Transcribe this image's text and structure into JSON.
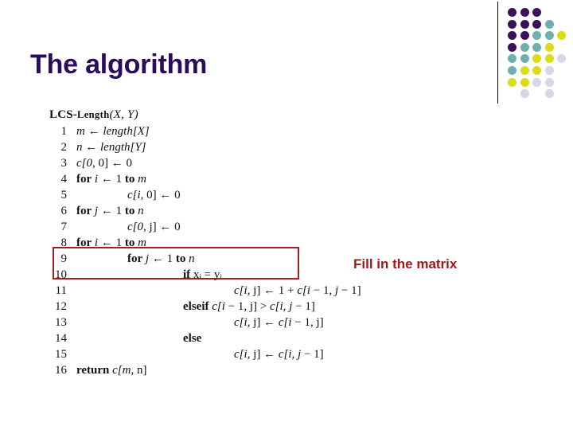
{
  "slide": {
    "title": "The algorithm",
    "title_color": "#2B0B5E",
    "background_color": "#FFFFFF"
  },
  "decor": {
    "name": "dot-grid-motif",
    "rule_color": "#000000",
    "colors": {
      "purple": "#3B1259",
      "teal": "#6FAFAF",
      "yellow": "#DBDB18",
      "lavender": "#D5D6E6"
    },
    "dots": [
      {
        "row": 0,
        "col": 0,
        "color": "#3B1259"
      },
      {
        "row": 0,
        "col": 1,
        "color": "#3B1259"
      },
      {
        "row": 0,
        "col": 2,
        "color": "#3B1259"
      },
      {
        "row": 1,
        "col": 0,
        "color": "#3B1259"
      },
      {
        "row": 1,
        "col": 1,
        "color": "#3B1259"
      },
      {
        "row": 1,
        "col": 2,
        "color": "#3B1259"
      },
      {
        "row": 1,
        "col": 3,
        "color": "#6FAFAF"
      },
      {
        "row": 2,
        "col": 0,
        "color": "#3B1259"
      },
      {
        "row": 2,
        "col": 1,
        "color": "#3B1259"
      },
      {
        "row": 2,
        "col": 2,
        "color": "#6FAFAF"
      },
      {
        "row": 2,
        "col": 3,
        "color": "#6FAFAF"
      },
      {
        "row": 2,
        "col": 4,
        "color": "#DBDB18"
      },
      {
        "row": 3,
        "col": 0,
        "color": "#3B1259"
      },
      {
        "row": 3,
        "col": 1,
        "color": "#6FAFAF"
      },
      {
        "row": 3,
        "col": 2,
        "color": "#6FAFAF"
      },
      {
        "row": 3,
        "col": 3,
        "color": "#DBDB18"
      },
      {
        "row": 4,
        "col": 0,
        "color": "#6FAFAF"
      },
      {
        "row": 4,
        "col": 1,
        "color": "#6FAFAF"
      },
      {
        "row": 4,
        "col": 2,
        "color": "#DBDB18"
      },
      {
        "row": 4,
        "col": 3,
        "color": "#DBDB18"
      },
      {
        "row": 4,
        "col": 4,
        "color": "#D5D6E6"
      },
      {
        "row": 5,
        "col": 0,
        "color": "#6FAFAF"
      },
      {
        "row": 5,
        "col": 1,
        "color": "#DBDB18"
      },
      {
        "row": 5,
        "col": 2,
        "color": "#DBDB18"
      },
      {
        "row": 5,
        "col": 3,
        "color": "#D5D6E6"
      },
      {
        "row": 6,
        "col": 0,
        "color": "#DBDB18"
      },
      {
        "row": 6,
        "col": 1,
        "color": "#DBDB18"
      },
      {
        "row": 6,
        "col": 2,
        "color": "#D5D6E6"
      },
      {
        "row": 6,
        "col": 3,
        "color": "#D5D6E6"
      },
      {
        "row": 7,
        "col": 1,
        "color": "#D5D6E6"
      },
      {
        "row": 7,
        "col": 3,
        "color": "#D5D6E6"
      }
    ]
  },
  "algorithm": {
    "header": {
      "name_main": "LCS-",
      "name_smallcaps": "Length",
      "params": "(X, Y)"
    },
    "lines": [
      {
        "no": "1",
        "indent": "i0",
        "text": "m ← length[X]"
      },
      {
        "no": "2",
        "indent": "i0",
        "text": "n ← length[Y]"
      },
      {
        "no": "3",
        "indent": "i0",
        "text": "c[0, 0] ← 0"
      },
      {
        "no": "4",
        "indent": "i0",
        "text": "for i ← 1 to m"
      },
      {
        "no": "5",
        "indent": "i1",
        "text": "c[i, 0] ← 0"
      },
      {
        "no": "6",
        "indent": "i0",
        "text": "for j ← 1 to n"
      },
      {
        "no": "7",
        "indent": "i1",
        "text": "c[0, j] ← 0"
      },
      {
        "no": "8",
        "indent": "i0",
        "text": "for i ← 1 to m"
      },
      {
        "no": "9",
        "indent": "i1",
        "text": "for j ← 1 to n"
      },
      {
        "no": "10",
        "indent": "i2",
        "text": "if xᵢ = yᵢ"
      },
      {
        "no": "11",
        "indent": "i3",
        "text": "c[i, j] ← 1 + c[i − 1, j − 1]"
      },
      {
        "no": "12",
        "indent": "i2",
        "text": "elseif c[i − 1, j] > c[i, j − 1]"
      },
      {
        "no": "13",
        "indent": "i3",
        "text": "c[i, j] ← c[i − 1, j]"
      },
      {
        "no": "14",
        "indent": "i2",
        "text": "else"
      },
      {
        "no": "15",
        "indent": "i3",
        "text": "c[i, j] ← c[i, j − 1]"
      },
      {
        "no": "16",
        "indent": "i0",
        "text": "return c[m, n]"
      }
    ]
  },
  "annotation": {
    "callout_text": "Fill in the matrix",
    "callout_color": "#A01818",
    "highlight_box_color": "#A02020",
    "highlight_covers_lines": "8-9"
  }
}
